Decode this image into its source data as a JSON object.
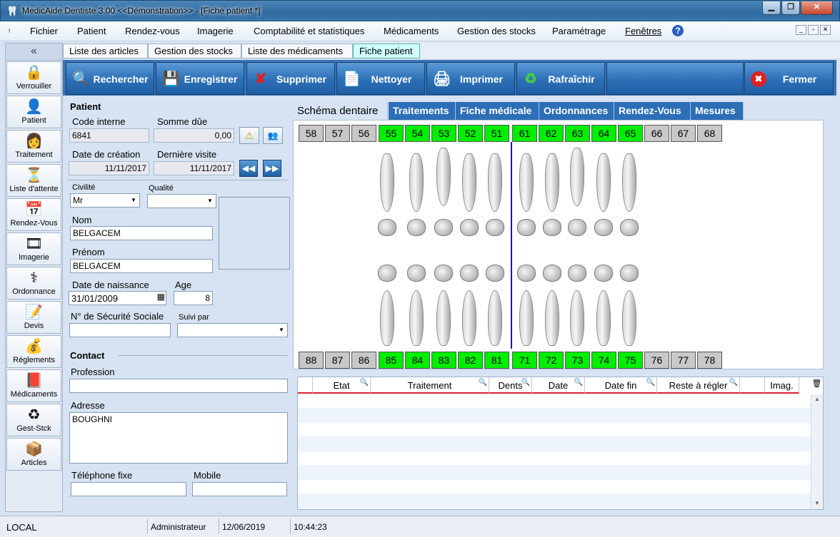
{
  "window": {
    "title": "MedicAide Dentiste 3.00 <<Démonstration>>  - [Fiche patient *]",
    "minimize": "▁",
    "maximize": "❐",
    "close": "✕"
  },
  "menu": {
    "items": [
      "Fichier",
      "Patient",
      "Rendez-vous",
      "Imagerie",
      "Comptabilité et statistiques",
      "Médicaments",
      "Gestion des stocks",
      "Paramétrage",
      "Fenêtres"
    ],
    "help": "?"
  },
  "sidebar": {
    "collapse": "«",
    "items": [
      {
        "label": "Verrouiller",
        "icon": "lock-icon",
        "glyph": "🔒"
      },
      {
        "label": "Patient",
        "icon": "patient-icon",
        "glyph": "👤"
      },
      {
        "label": "Traitement",
        "icon": "treatment-icon",
        "glyph": "👩"
      },
      {
        "label": "Liste d'attente",
        "icon": "hourglass-icon",
        "glyph": "⏳"
      },
      {
        "label": "Rendez-Vous",
        "icon": "calendar-clock-icon",
        "glyph": "📅"
      },
      {
        "label": "Imagerie",
        "icon": "film-icon",
        "glyph": "🎞"
      },
      {
        "label": "Ordonnance",
        "icon": "caduceus-icon",
        "glyph": "⚕"
      },
      {
        "label": "Devis",
        "icon": "document-pen-icon",
        "glyph": "📝"
      },
      {
        "label": "Réglements",
        "icon": "money-icon",
        "glyph": "💰"
      },
      {
        "label": "Médicaments",
        "icon": "book-icon",
        "glyph": "📕"
      },
      {
        "label": "Gest-Stck",
        "icon": "recycle-icon",
        "glyph": "♻"
      },
      {
        "label": "Articles",
        "icon": "box-icon",
        "glyph": "📦"
      }
    ]
  },
  "subtabs": [
    "Liste des articles",
    "Gestion des stocks",
    "Liste des médicaments",
    "Fiche patient"
  ],
  "toolbar": [
    {
      "label": "Rechercher",
      "icon": "search-icon",
      "glyph": "🔍"
    },
    {
      "label": "Enregistrer",
      "icon": "save-icon",
      "glyph": "💾"
    },
    {
      "label": "Supprimer",
      "icon": "delete-icon",
      "glyph": "✘"
    },
    {
      "label": "Nettoyer",
      "icon": "clear-icon",
      "glyph": "📄"
    },
    {
      "label": "Imprimer",
      "icon": "print-icon",
      "glyph": "🖨"
    },
    {
      "label": "Rafraîchir",
      "icon": "refresh-icon",
      "glyph": "♻"
    },
    {
      "label": "Fermer",
      "icon": "close-icon",
      "glyph": "✖"
    }
  ],
  "patient": {
    "heading": "Patient",
    "code_label": "Code interne",
    "code": "6841",
    "due_label": "Somme dûe",
    "due": "0,00",
    "created_label": "Date de création",
    "created": "11/11/2017",
    "last_visit_label": "Dernière visite",
    "last_visit": "11/11/2017",
    "civility_label": "Civilité",
    "civility": "Mr",
    "quality_label": "Qualité",
    "quality": "",
    "name_label": "Nom",
    "name": "BELGACEM",
    "firstname_label": "Prénom",
    "firstname": "BELGACEM",
    "birth_label": "Date de naissance",
    "birth": "31/01/2009",
    "age_label": "Age",
    "age": "8",
    "ssn_label": "N° de Sécurité Sociale",
    "ssn": "",
    "followed_label": "Suivi par",
    "followed": ""
  },
  "contact": {
    "heading": "Contact",
    "profession_label": "Profession",
    "profession": "",
    "address_label": "Adresse",
    "address": "BOUGHNI",
    "phone_label": "Téléphone fixe",
    "phone": "",
    "mobile_label": "Mobile",
    "mobile": ""
  },
  "right_tabs": [
    "Schéma dentaire",
    "Traitements",
    "Fiche médicale",
    "Ordonnances",
    "Rendez-Vous",
    "Mesures"
  ],
  "teeth": {
    "upper": [
      {
        "n": "58",
        "active": false
      },
      {
        "n": "57",
        "active": false
      },
      {
        "n": "56",
        "active": false
      },
      {
        "n": "55",
        "active": true
      },
      {
        "n": "54",
        "active": true
      },
      {
        "n": "53",
        "active": true
      },
      {
        "n": "52",
        "active": true
      },
      {
        "n": "51",
        "active": true
      },
      {
        "n": "61",
        "active": true
      },
      {
        "n": "62",
        "active": true
      },
      {
        "n": "63",
        "active": true
      },
      {
        "n": "64",
        "active": true
      },
      {
        "n": "65",
        "active": true
      },
      {
        "n": "66",
        "active": false
      },
      {
        "n": "67",
        "active": false
      },
      {
        "n": "68",
        "active": false
      }
    ],
    "lower": [
      {
        "n": "88",
        "active": false
      },
      {
        "n": "87",
        "active": false
      },
      {
        "n": "86",
        "active": false
      },
      {
        "n": "85",
        "active": true
      },
      {
        "n": "84",
        "active": true
      },
      {
        "n": "83",
        "active": true
      },
      {
        "n": "82",
        "active": true
      },
      {
        "n": "81",
        "active": true
      },
      {
        "n": "71",
        "active": true
      },
      {
        "n": "72",
        "active": true
      },
      {
        "n": "73",
        "active": true
      },
      {
        "n": "74",
        "active": true
      },
      {
        "n": "75",
        "active": true
      },
      {
        "n": "76",
        "active": false
      },
      {
        "n": "77",
        "active": false
      },
      {
        "n": "78",
        "active": false
      }
    ]
  },
  "grid": {
    "columns": [
      "Etat",
      "Traitement",
      "Dents",
      "Date",
      "Date fin",
      "Reste à régler",
      "",
      "Imag."
    ],
    "rows": []
  },
  "status": {
    "location": "LOCAL",
    "user": "Administrateur",
    "date": "12/06/2019",
    "time": "10:44:23"
  }
}
